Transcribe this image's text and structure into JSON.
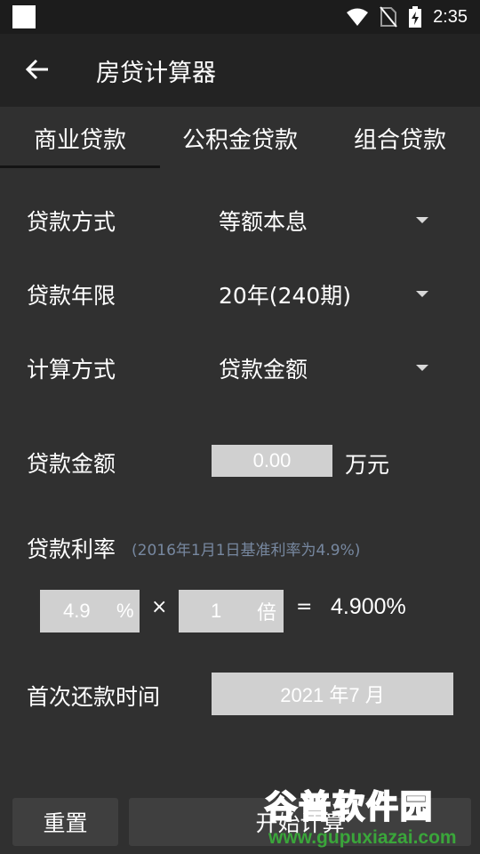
{
  "status_bar": {
    "time": "2:35"
  },
  "toolbar": {
    "title": "房贷计算器"
  },
  "tabs": [
    {
      "label": "商业贷款",
      "selected": true
    },
    {
      "label": "公积金贷款",
      "selected": false
    },
    {
      "label": "组合贷款",
      "selected": false
    }
  ],
  "form": {
    "loan_method": {
      "label": "贷款方式",
      "value": "等额本息"
    },
    "loan_term": {
      "label": "贷款年限",
      "value": "20年(240期)"
    },
    "calc_method": {
      "label": "计算方式",
      "value": "贷款金额"
    },
    "loan_amount": {
      "label": "贷款金额",
      "value": "0.00",
      "unit": "万元"
    },
    "interest": {
      "label": "贷款利率",
      "hint": "(2016年1月1日基准利率为4.9%)",
      "rate": "4.9",
      "rate_unit": "%",
      "multiply_sign": "×",
      "multiplier": "1",
      "multiplier_unit": "倍",
      "equals_sign": "=",
      "result": "4.900%"
    },
    "first_payment": {
      "label": "首次还款时间",
      "value": "2021 年7 月"
    }
  },
  "buttons": {
    "reset": "重置",
    "start": "开始计算"
  },
  "watermark": {
    "line1": "谷普软件园",
    "line2": "www.gupuxiazai.com"
  },
  "colors": {
    "background": "#303030",
    "toolbar": "#232323",
    "input": "#d0d0d0",
    "watermark_green": "#3aa63a"
  }
}
